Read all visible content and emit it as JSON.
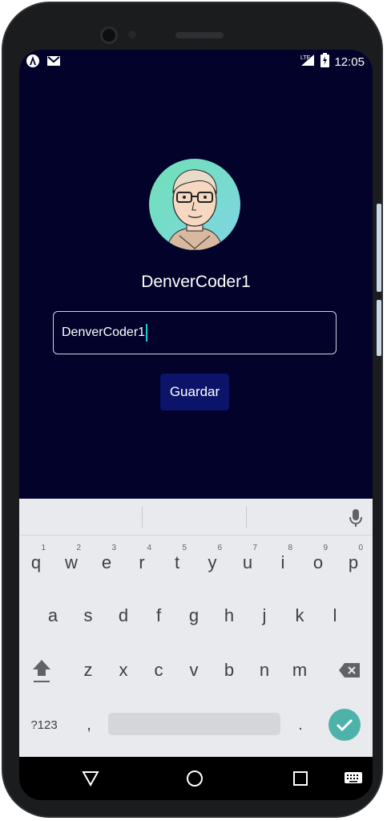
{
  "status_bar": {
    "time": "12:05",
    "left_icons": [
      "notification-a-icon",
      "gmail-icon"
    ],
    "right_icons": [
      "lte-signal-icon",
      "battery-charging-icon"
    ]
  },
  "profile": {
    "username": "DenverCoder1",
    "avatar": "avatar-illustration"
  },
  "name_field": {
    "value": "DenverCoder1"
  },
  "save_button": {
    "label": "Guardar",
    "color": "#0b1468"
  },
  "keyboard": {
    "row1": [
      {
        "key": "q",
        "hint": "1"
      },
      {
        "key": "w",
        "hint": "2"
      },
      {
        "key": "e",
        "hint": "3"
      },
      {
        "key": "r",
        "hint": "4"
      },
      {
        "key": "t",
        "hint": "5"
      },
      {
        "key": "y",
        "hint": "6"
      },
      {
        "key": "u",
        "hint": "7"
      },
      {
        "key": "i",
        "hint": "8"
      },
      {
        "key": "o",
        "hint": "9"
      },
      {
        "key": "p",
        "hint": "0"
      }
    ],
    "row2": [
      "a",
      "s",
      "d",
      "f",
      "g",
      "h",
      "j",
      "k",
      "l"
    ],
    "row3": [
      "z",
      "x",
      "c",
      "v",
      "b",
      "n",
      "m"
    ],
    "symbols_label": "?123",
    "comma": ",",
    "period": ".",
    "enter_color": "#4db3aa"
  },
  "colors": {
    "background": "#02022a",
    "caret": "#19d0d0"
  }
}
